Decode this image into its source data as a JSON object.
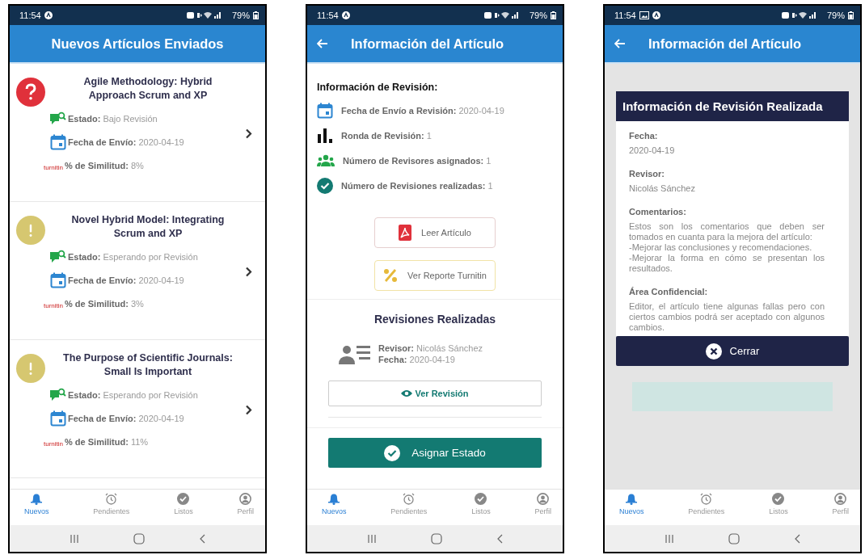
{
  "phones": [
    {
      "kind": "list",
      "status_bar": {
        "time": "11:54",
        "gallery_notification": false,
        "battery": "79%"
      },
      "app_bar": {
        "title": "Nuevos Artículos Enviados",
        "back": false
      },
      "articles": [
        {
          "kind": "question",
          "title": "Agile Methodology: Hybrid Approach Scrum and XP",
          "estado": "**Estado:** Bajo Revisión",
          "fecha": "**Fecha de Envío:** 2020-04-19",
          "logo": "turnitin",
          "similitud": "**% de Similitud:** 8%"
        },
        {
          "kind": "waiting",
          "title": "Novel Hybrid Model: Integrating Scrum and XP",
          "estado": "**Estado:** Esperando por Revisión",
          "fecha": "**Fecha de Envío:** 2020-04-19",
          "logo": "turnitin",
          "similitud": "**% de Similitud:** 3%"
        },
        {
          "kind": "waiting",
          "title": "The Purpose of Scientific Journals: Small Is Important",
          "estado": "**Estado:** Esperando por Revisión",
          "fecha": "**Fecha de Envío:** 2020-04-19",
          "logo": "turnitin",
          "similitud": "**% de Similitud:** 11%"
        }
      ],
      "bottom_nav": [
        {
          "kind": "bell",
          "label": "Nuevos",
          "selected": true
        },
        {
          "kind": "alarm",
          "label": "Pendientes",
          "selected": false
        },
        {
          "kind": "check",
          "label": "Listos",
          "selected": false
        },
        {
          "kind": "person",
          "label": "Perfil",
          "selected": false
        }
      ]
    },
    {
      "kind": "detail",
      "status_bar": {
        "time": "11:54",
        "gallery_notification": false,
        "battery": "79%"
      },
      "app_bar": {
        "title": "Información del Artículo",
        "back": true
      },
      "section_title": "Información de Revisión:",
      "info_rows": [
        {
          "kind": "calendar",
          "text": "**Fecha de Envío a Revisión:** 2020-04-19"
        },
        {
          "kind": "bars",
          "text": "**Ronda de Revisión:** 1"
        },
        {
          "kind": "people",
          "text": "**Número de Revisores asignados:** 1"
        },
        {
          "kind": "check",
          "text": "**Número de Revisiones realizadas:** 1"
        }
      ],
      "buttons": [
        {
          "kind": "pdf",
          "label": "Leer Artículo"
        },
        {
          "kind": "percent",
          "label": "Ver Reporte Turnitin"
        }
      ],
      "reviews_title": "Revisiones Realizadas",
      "review": {
        "reviewer": "**Revisor:** Nicolás Sánchez",
        "date": "**Fecha:** 2020-04-19",
        "button": "Ver Revisión"
      },
      "primary_button": "Asignar Estado",
      "bottom_nav": [
        {
          "kind": "bell",
          "label": "Nuevos",
          "selected": true
        },
        {
          "kind": "alarm",
          "label": "Pendientes",
          "selected": false
        },
        {
          "kind": "check",
          "label": "Listos",
          "selected": false
        },
        {
          "kind": "person",
          "label": "Perfil",
          "selected": false
        }
      ]
    },
    {
      "kind": "modal",
      "status_bar": {
        "time": "11:54",
        "gallery_notification": true,
        "battery": "79%"
      },
      "app_bar": {
        "title": "Información del Artículo",
        "back": true
      },
      "modal": {
        "title": "Información de Revisión Realizada",
        "fields": [
          {
            "label": "Fecha:",
            "value": "2020-04-19"
          },
          {
            "label": "Revisor:",
            "value": "Nicolás Sánchez"
          },
          {
            "label": "Comentarios:",
            "value": " Estos son los comentarios que deben ser tomados en cuanta para la mejora del artículo:\n-Mejorar las conclusiones y recomendaciones.\n-Mejorar la forma en cómo se presentan los resultados."
          },
          {
            "label": "Área Confidencial:",
            "value": " Editor, el artículo tiene algunas fallas pero con ciertos cambios podrá ser aceptado con algunos cambios."
          }
        ],
        "close_button": "Cerrar"
      },
      "bottom_nav": [
        {
          "kind": "bell",
          "label": "Nuevos",
          "selected": true
        },
        {
          "kind": "alarm",
          "label": "Pendientes",
          "selected": false
        },
        {
          "kind": "check",
          "label": "Listos",
          "selected": false
        },
        {
          "kind": "person",
          "label": "Perfil",
          "selected": false
        }
      ]
    }
  ]
}
